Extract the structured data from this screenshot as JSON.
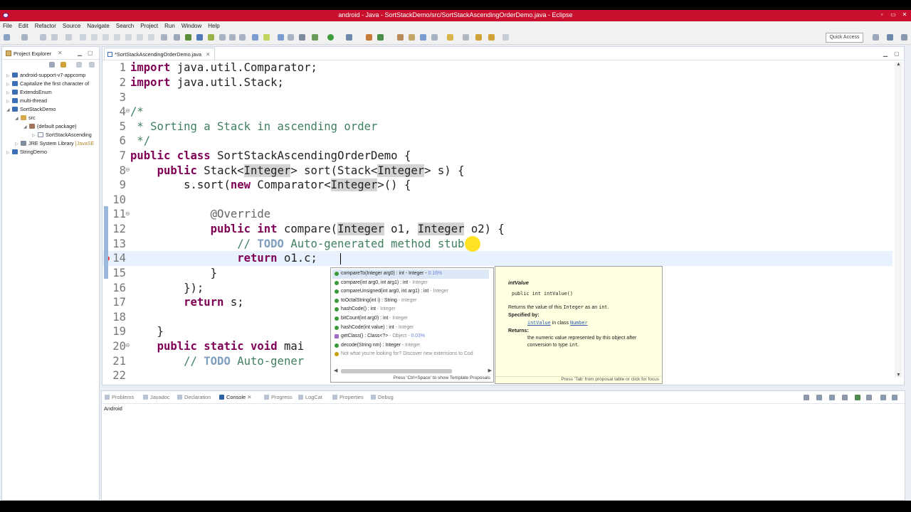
{
  "window": {
    "title": "android - Java - SortStackDemo/src/SortStackAscendingOrderDemo.java - Eclipse",
    "minimize": "▫",
    "maximize": "▭",
    "close": "✕"
  },
  "menu": [
    "File",
    "Edit",
    "Refactor",
    "Source",
    "Navigate",
    "Search",
    "Project",
    "Run",
    "Window",
    "Help"
  ],
  "toolbar": {
    "quick_access_placeholder": "Quick Access"
  },
  "project_explorer": {
    "title": "Project Explorer",
    "close": "✕",
    "items": [
      {
        "label": "android-support-v7-appcomp",
        "extra": ""
      },
      {
        "label": "Capitalize the first character of",
        "extra": ""
      },
      {
        "label": "ExtendsEnum",
        "extra": ""
      },
      {
        "label": "multi-thread",
        "extra": ""
      },
      {
        "label": "SortStackDemo",
        "extra": ""
      },
      {
        "label": "src",
        "extra": ""
      },
      {
        "label": "(default package)",
        "extra": ""
      },
      {
        "label": "SortStackAscending",
        "extra": ""
      },
      {
        "label": "JRE System Library ",
        "extra": "[JavaSE"
      },
      {
        "label": "StringDemo",
        "extra": ""
      }
    ]
  },
  "editor": {
    "tab_label": "*SortStackAscendingOrderDemo.java",
    "tab_close": "✕",
    "lines": {
      "l1": {
        "n": "1",
        "kw": "import",
        "rest": " java.util.Comparator;"
      },
      "l2": {
        "n": "2",
        "kw": "import",
        "rest": " java.util.Stack;"
      },
      "l3": {
        "n": "3"
      },
      "l4": {
        "n": "4",
        "text": "/*"
      },
      "l5": {
        "n": "5",
        "text": " * Sorting a Stack in ascending order"
      },
      "l6": {
        "n": "6",
        "text": " */"
      },
      "l7": {
        "n": "7",
        "kw1": "public",
        "kw2": "class",
        "rest": " SortStackAscendingOrderDemo {"
      },
      "l8": {
        "n": "8",
        "indent": "    ",
        "kw": "public",
        "a": " Stack<",
        "h1": "Integer",
        "b": "> sort(Stack<",
        "h2": "Integer",
        "c": "> s) {"
      },
      "l9": {
        "n": "9",
        "indent": "        ",
        "a": "s.sort(",
        "kw": "new",
        "b": " Comparator<",
        "h1": "Integer",
        "c": ">() {"
      },
      "l10": {
        "n": "10"
      },
      "l11": {
        "n": "11",
        "indent": "            ",
        "ann": "@Override"
      },
      "l12": {
        "n": "12",
        "indent": "            ",
        "kw1": "public",
        "kw2": "int",
        "a": " compare(",
        "h1": "Integer",
        "b": " o1, ",
        "h2": "Integer",
        "c": " o2) {"
      },
      "l13": {
        "n": "13",
        "indent": "                ",
        "cm1": "// ",
        "todo": "TODO",
        "cm2": " Auto-generated method stub"
      },
      "l14": {
        "n": "14",
        "indent": "                ",
        "kw": "return",
        "rest": " o1.c;"
      },
      "l15": {
        "n": "15",
        "text": "            }"
      },
      "l16": {
        "n": "16",
        "text": "        });"
      },
      "l17": {
        "n": "17",
        "indent": "        ",
        "kw": "return",
        "rest": " s;"
      },
      "l18": {
        "n": "18"
      },
      "l19": {
        "n": "19",
        "text": "    }"
      },
      "l20": {
        "n": "20",
        "indent": "    ",
        "kw1": "public",
        "kw2": "static",
        "kw3": "void",
        "rest": " mai"
      },
      "l21": {
        "n": "21",
        "indent": "        ",
        "cm1": "// ",
        "todo": "TODO",
        "cm2": " Auto-gener"
      },
      "l22": {
        "n": "22"
      }
    }
  },
  "proposals": {
    "items": [
      {
        "name": "compareTo(Integer arg0) : int - Integer - ",
        "pct": "0.16%",
        "sub": "",
        "kind": "method"
      },
      {
        "name": "compare(int arg0, int arg1) : int",
        "pct": "",
        "sub": " - Integer",
        "kind": "method"
      },
      {
        "name": "compareUnsigned(int arg0, int arg1) : int",
        "pct": "",
        "sub": " - Integer",
        "kind": "method"
      },
      {
        "name": "toOctalString(int i) : String",
        "pct": "",
        "sub": " - Integer",
        "kind": "method"
      },
      {
        "name": "hashCode() : int",
        "pct": "",
        "sub": " - Integer",
        "kind": "method"
      },
      {
        "name": "bitCount(int arg0) : int",
        "pct": "",
        "sub": " - Integer",
        "kind": "method"
      },
      {
        "name": "hashCode(int value) : int",
        "pct": "",
        "sub": " - Integer",
        "kind": "method"
      },
      {
        "name": "getClass() : Class<?>",
        "pct": "0.03%",
        "sub": " - Object - ",
        "kind": "class"
      },
      {
        "name": "decode(String nm) : Integer",
        "pct": "",
        "sub": " - Integer",
        "kind": "method"
      },
      {
        "name": "",
        "pct": "",
        "sub": "Not what you're looking for? Discover new extensions to Cod",
        "kind": "hint"
      }
    ],
    "footer": "Press 'Ctrl+Space' to show Template Proposals"
  },
  "javadoc": {
    "name": "intValue",
    "signature": "public int intValue()",
    "desc_pre": "Returns the value of this ",
    "desc_code1": "Integer",
    "desc_mid": " as an ",
    "desc_code2": "int",
    "desc_end": ".",
    "specified_by": "Specified by:",
    "spec_link": "intValue",
    "spec_mid": " in class ",
    "spec_class": "Number",
    "returns": "Returns:",
    "returns_text1": "the numeric value represented by this object after",
    "returns_text2": "conversion to type ",
    "returns_code": "int",
    "returns_end": ".",
    "footer": "Press 'Tab' from proposal table or click for focus"
  },
  "bottom_panel": {
    "tabs": [
      "Problems",
      "Javadoc",
      "Declaration",
      "Console",
      "Progress",
      "LogCat",
      "Properties",
      "Debug"
    ],
    "active": "Console",
    "console_close": "✕",
    "console_label": "Android"
  }
}
